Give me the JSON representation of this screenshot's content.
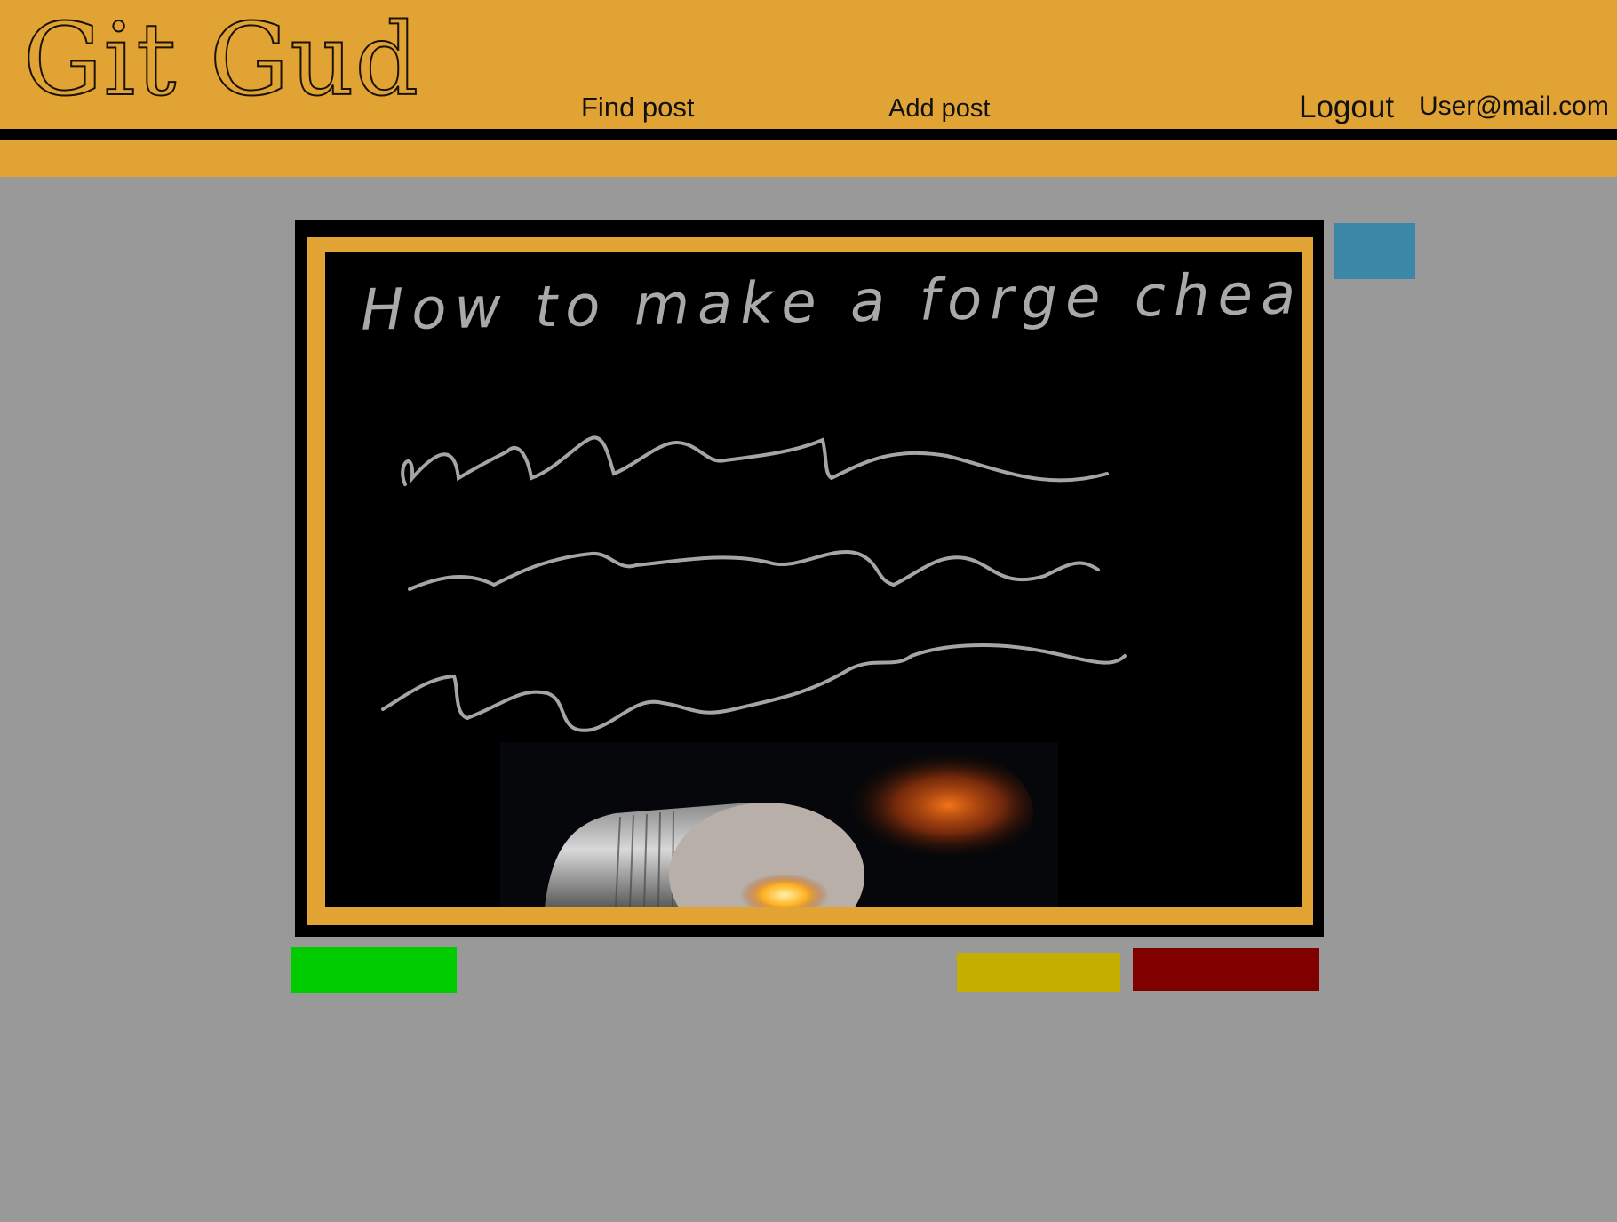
{
  "header": {
    "logo_text": "Git Gud",
    "nav": {
      "find_post": "Find post",
      "add_post": "Add post",
      "logout": "Logout"
    },
    "user_email": "User@mail.com"
  },
  "post": {
    "title": "How to make a forge cheap",
    "body_lines": 3
  },
  "colors": {
    "accent_orange": "#E0A334",
    "page_bg": "#999999",
    "side_button": "#3B87A8",
    "green_button": "#00CC00",
    "yellow_button": "#C4AE00",
    "red_button": "#800000"
  }
}
